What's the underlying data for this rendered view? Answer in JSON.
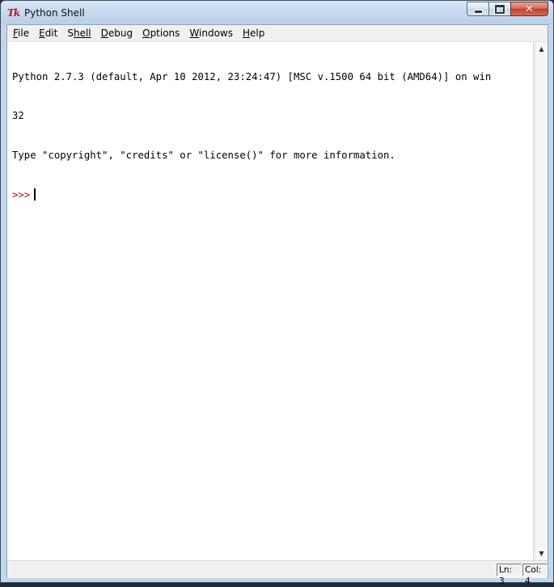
{
  "window": {
    "title": "Python Shell",
    "icon": "tk-icon",
    "caption_minimize": "minimize-icon",
    "caption_maximize": "maximize-icon",
    "caption_close": "close-icon",
    "close_glyph": "✕"
  },
  "menu": {
    "items": [
      {
        "first": "F",
        "rest": "ile"
      },
      {
        "first": "E",
        "rest": "dit"
      },
      {
        "first": "S",
        "rest": "hell"
      },
      {
        "first": "D",
        "rest": "ebug"
      },
      {
        "first": "O",
        "rest": "ptions"
      },
      {
        "first": "W",
        "rest": "indows"
      },
      {
        "first": "H",
        "rest": "elp"
      }
    ]
  },
  "shell": {
    "lines": [
      "Python 2.7.3 (default, Apr 10 2012, 23:24:47) [MSC v.1500 64 bit (AMD64)] on win",
      "32",
      "Type \"copyright\", \"credits\" or \"license()\" for more information."
    ],
    "prompt": ">>>"
  },
  "scrollbar": {
    "up_glyph": "▲",
    "down_glyph": "▼"
  },
  "status": {
    "ln": "Ln: 3",
    "col": "Col: 4"
  }
}
